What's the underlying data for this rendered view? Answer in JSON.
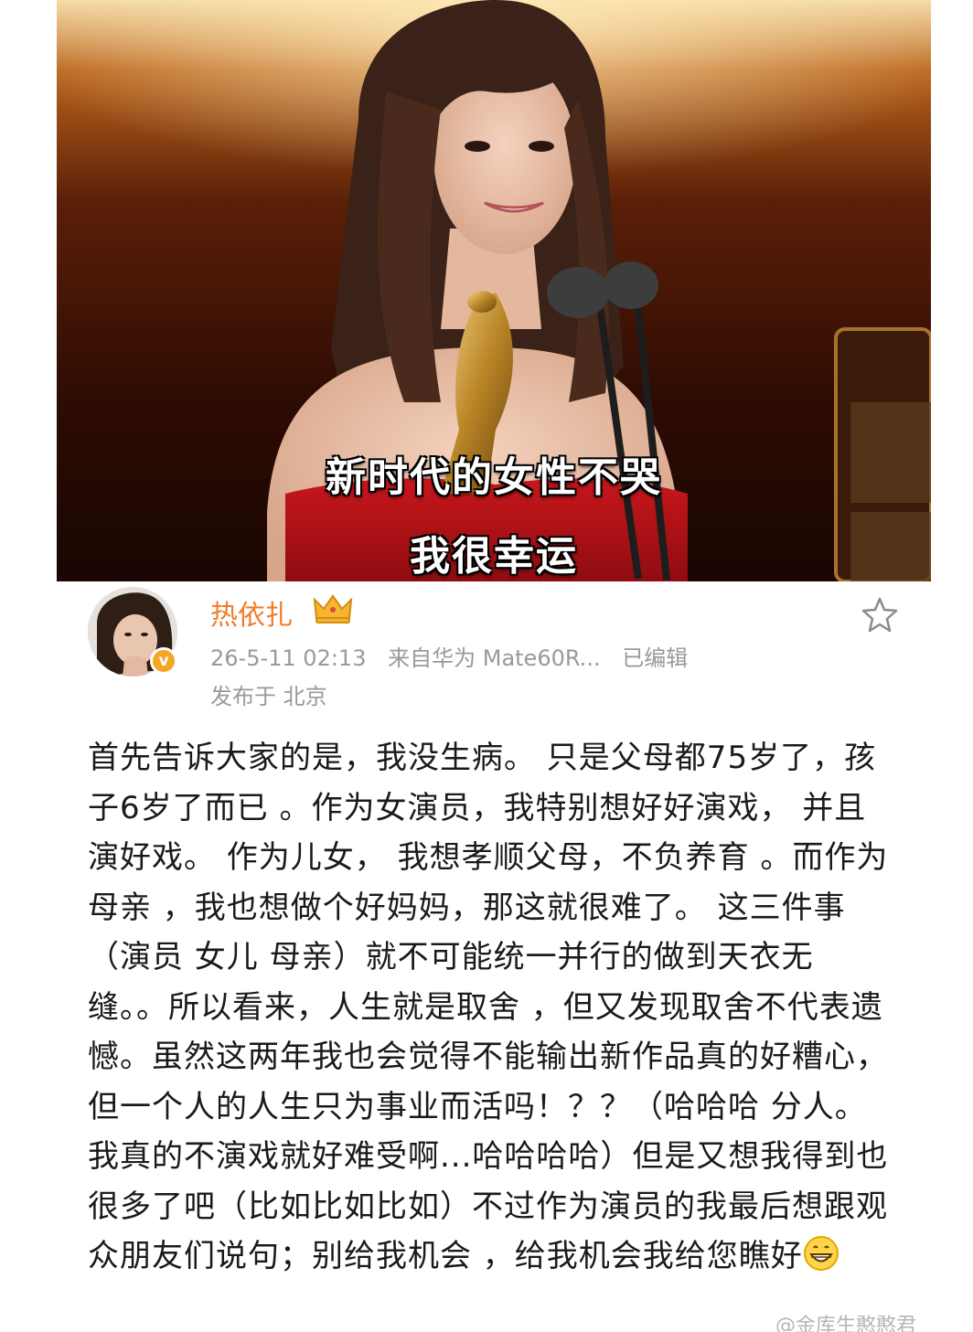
{
  "video": {
    "subtitle_line1": "新时代的女性不哭",
    "subtitle_line2": "我很幸运"
  },
  "post": {
    "username": "热依扎",
    "datetime": "26-5-11 02:13",
    "source": "来自华为 Mate60R...",
    "edited": "已编辑",
    "location": "发布于 北京",
    "body": "首先告诉大家的是，我没生病。 只是父母都75岁了，孩子6岁了而已 。作为女演员，我特别想好好演戏， 并且演好戏。 作为儿女， 我想孝顺父母，不负养育 。而作为母亲 ，我也想做个好妈妈，那这就很难了。 这三件事（演员 女儿 母亲）就不可能统一并行的做到天衣无缝。。所以看来，人生就是取舍 ，但又发现取舍不代表遗憾。虽然这两年我也会觉得不能输出新作品真的好糟心，但一个人的人生只为事业而活吗！？？（哈哈哈 分人。我真的不演戏就好难受啊...哈哈哈哈）但是又想我得到也很多了吧（比如比如比如）不过作为演员的我最后想跟观众朋友们说句；别给我机会 ，给我机会我给您瞧好",
    "trailing_emoji": "grinning-face-emoji"
  },
  "watermark": "@金库生憨憨君",
  "icons": {
    "crown": "crown-vip-icon",
    "star": "star-favorite-icon",
    "verified": "verified-v-badge-icon"
  },
  "colors": {
    "username": "#f07c2a",
    "meta": "#999999",
    "body_text": "#1a1a1a",
    "verified_badge": "#f5a623"
  }
}
